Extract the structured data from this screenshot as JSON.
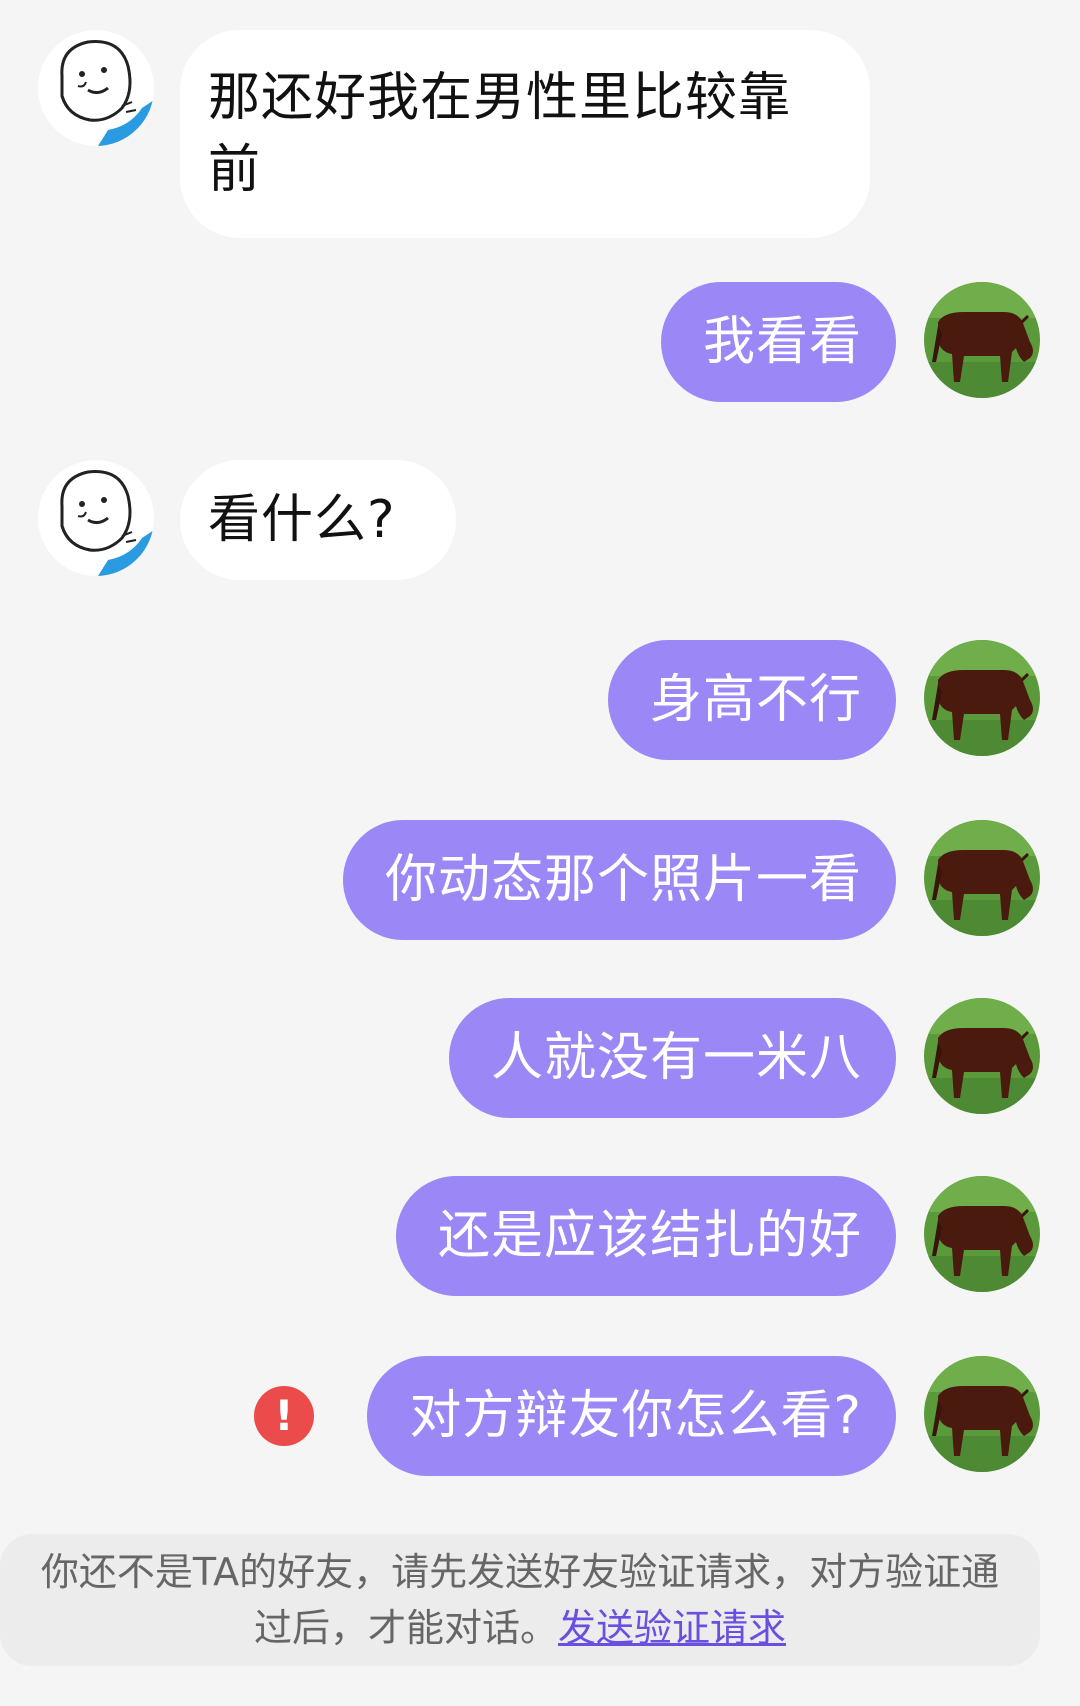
{
  "messages": [
    {
      "side": "in",
      "text": "那还好我在男性里比较靠前",
      "avatar": "doodle-face-icon"
    },
    {
      "side": "out",
      "text": "我看看",
      "avatar": "cow-avatar"
    },
    {
      "side": "in",
      "text": "看什么?",
      "avatar": "doodle-face-icon"
    },
    {
      "side": "out",
      "text": "身高不行",
      "avatar": "cow-avatar"
    },
    {
      "side": "out",
      "text": "你动态那个照片一看",
      "avatar": "cow-avatar"
    },
    {
      "side": "out",
      "text": "人就没有一米八",
      "avatar": "cow-avatar"
    },
    {
      "side": "out",
      "text": "还是应该结扎的好",
      "avatar": "cow-avatar"
    },
    {
      "side": "out",
      "text": "对方辩友你怎么看?",
      "avatar": "cow-avatar",
      "status": "failed"
    }
  ],
  "error_icon": "!",
  "notice": {
    "text": "你还不是TA的好友，请先发送好友验证请求，对方验证通过后，才能对话。",
    "link": "发送验证请求"
  },
  "colors": {
    "outgoing_bubble": "#9b87f5",
    "incoming_bubble": "#ffffff",
    "background": "#f5f5f5",
    "error": "#eb4b4b",
    "link": "#6b4fe0"
  }
}
